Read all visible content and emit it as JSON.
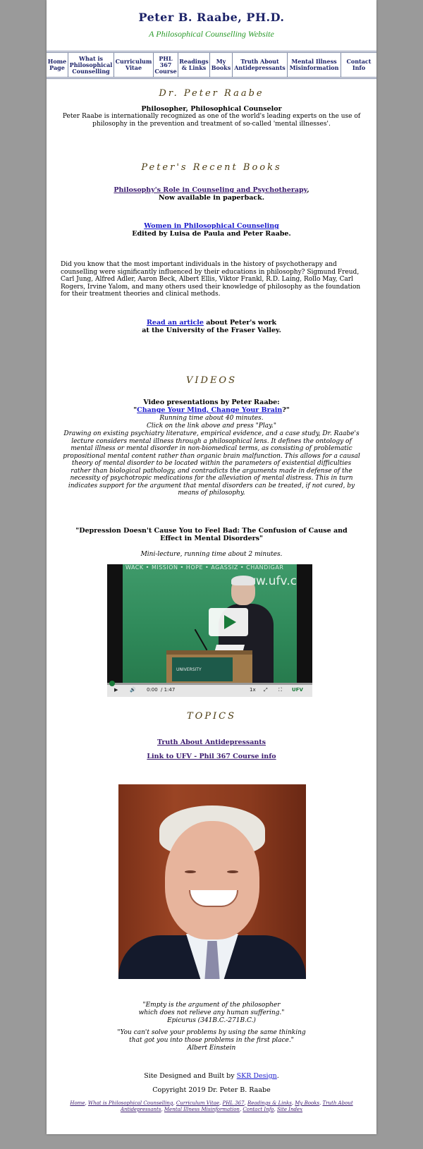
{
  "header": {
    "title": "Peter B. Raabe, PH.D.",
    "subtitle": "A Philosophical Counselling Website"
  },
  "nav": [
    {
      "label": "Home Page"
    },
    {
      "label": "What is Philosophical Counselling"
    },
    {
      "label": "Curriculum Vitae"
    },
    {
      "label": "PHL 367 Course"
    },
    {
      "label": "Readings & Links"
    },
    {
      "label": "My Books"
    },
    {
      "label": "Truth About Antidepressants"
    },
    {
      "label": "Mental Illness Misinformation"
    },
    {
      "label": "Contact Info"
    }
  ],
  "intro": {
    "name": "Dr. Peter Raabe",
    "role": "Philosopher, Philosophical Counselor",
    "text": "Peter Raabe is internationally recognized as one of the world's leading experts on the use of philosophy in the prevention and treatment of so-called 'mental illnesses'."
  },
  "books": {
    "heading": "Peter's Recent Books",
    "book1_title": "Philosophy's Role in Counseling and Psychotherapy",
    "book1_comma": ",",
    "book1_note": "Now available in paperback.",
    "book2_title": "Women in Philosophical Counseling",
    "book2_note": "Edited by Luisa de Paula and Peter Raabe."
  },
  "didyouknow": "Did you know that the most important individuals in the history of psychotherapy and counselling were significantly influenced by their educations in philosophy? Sigmund Freud, Carl Jung, Alfred Adler, Aaron Beck, Albert Ellis, Viktor Frankl, R.D. Laing, Rollo May, Carl Rogers, Irvine Yalom, and many others used their knowledge of philosophy as the foundation for their treatment theories and clinical methods.",
  "article": {
    "link": "Read an article",
    "rest": " about Peter's work",
    "line2": "at the University of the Fraser Valley."
  },
  "videos": {
    "heading": "VIDEOS",
    "intro": "Video presentations by Peter Raabe:",
    "quote_open": "\"",
    "video1_link": "Change Your Mind, Change Your Brain",
    "quote_close": "?\"",
    "running": "Running time about 40 minutes.",
    "instruction": "Click on the link above and press \"Play.\"",
    "description": "Drawing on existing psychiatry literature, empirical evidence, and a case study, Dr. Raabe's lecture considers mental illness through a philosophical lens. It defines the ontology of mental illness or mental disorder in non-biomedical terms, as consisting of problematic propositional mental content rather than organic brain malfunction. This allows for a causal theory of mental disorder to be located within the parameters of existential difficulties rather than biological pathology, and contradicts the arguments made in defense of the necessity of psychotropic medications for the alleviation of mental distress. This in turn indicates support for the argument that mental disorders can be treated, if not cured, by means of philosophy.",
    "video2_title": "\"Depression Doesn't Cause You to Feel Bad: The Confusion of Cause and Effect in Mental Disorders\"",
    "video2_note": "Mini-lecture, running time about 2 minutes.",
    "player": {
      "banner": "WACK • MISSION • HOPE • AGASSIZ • CHANDIGAR",
      "url": "ww.ufv.c",
      "podium_text": "UNIVERSITY",
      "time": "0:00",
      "duration": "/ 1:47",
      "speed": "1x",
      "brand": "UFV",
      "progress": 0
    }
  },
  "topics": {
    "heading": "TOPICS",
    "link1": "Truth About Antidepressants",
    "link2": "Link to UFV - Phil 367 Course info"
  },
  "quotes": {
    "q1_line1": "\"Empty is the argument of the philosopher",
    "q1_line2": "which does not relieve any human suffering.\"",
    "q1_author": "Epicurus (341B.C.-271B.C.)",
    "q2_line1": "\"You can't solve your problems by using the same thinking",
    "q2_line2": "that got you into those problems in the first place.\"",
    "q2_author": "Albert Einstein"
  },
  "footer": {
    "designed": "Site Designed and Built by ",
    "designer_link": "SKR Design",
    "period": ".",
    "copyright": "Copyright 2019 Dr. Peter B. Raabe",
    "links": [
      "Home",
      "What is Philosophical Counselling",
      "Curriculum Vitae",
      "PHL 367",
      "Readings & Links",
      "My Books",
      "Truth About Antidepressants",
      "Mental Illness Misinformation",
      "Contact Info",
      "Site Index"
    ]
  },
  "colors": {
    "background": "#9a9a9a",
    "title": "#1c2268",
    "subtitle": "#2a9a2a",
    "visited_link": "#3a1a6e",
    "link": "#1a1acc",
    "section_heading": "#4a3a10"
  }
}
